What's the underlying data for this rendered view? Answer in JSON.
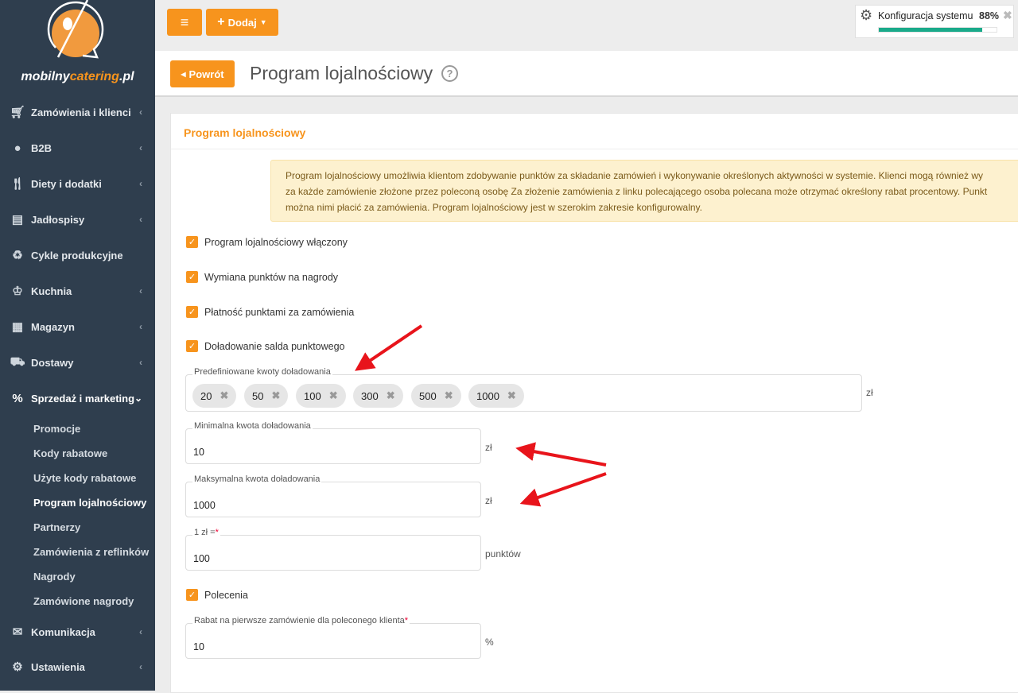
{
  "brand": {
    "name_part1": "mobilny",
    "name_part2": "catering",
    "name_part3": ".pl"
  },
  "sidebar": {
    "items": [
      {
        "label": "Zamówienia i klienci",
        "icon": "cart-icon"
      },
      {
        "label": "B2B",
        "icon": "user-icon"
      },
      {
        "label": "Diety i dodatki",
        "icon": "cutlery-icon"
      },
      {
        "label": "Jadłospisy",
        "icon": "list-icon"
      },
      {
        "label": "Cykle produkcyjne",
        "icon": "recycle-icon"
      },
      {
        "label": "Kuchnia",
        "icon": "chef-hat-icon"
      },
      {
        "label": "Magazyn",
        "icon": "boxes-icon"
      },
      {
        "label": "Dostawy",
        "icon": "truck-icon"
      },
      {
        "label": "Sprzedaż i marketing",
        "icon": "percent-icon"
      }
    ],
    "subitems": [
      "Promocje",
      "Kody rabatowe",
      "Użyte kody rabatowe",
      "Program lojalnościowy",
      "Partnerzy",
      "Zamówienia z reflinków",
      "Nagrody",
      "Zamówione nagrody"
    ],
    "bottom": [
      {
        "label": "Komunikacja",
        "icon": "envelope-icon"
      },
      {
        "label": "Ustawienia",
        "icon": "gear-icon"
      }
    ]
  },
  "topbar": {
    "menu_icon": "≡",
    "add_label": "Dodaj"
  },
  "config": {
    "label": "Konfiguracja systemu",
    "percent_text": "88%",
    "progress": 0.88,
    "color": "#1aaa8a"
  },
  "header": {
    "back_label": "Powrót",
    "title": "Program lojalnościowy"
  },
  "card": {
    "title": "Program lojalnościowy",
    "info_lines": [
      "Program lojalnościowy umożliwia klientom zdobywanie punktów za składanie zamówień i wykonywanie określonych aktywności w systemie. Klienci mogą również wy",
      "za każde zamówienie złożone przez poleconą osobę Za złożenie zamówienia z linku polecającego osoba polecana może otrzymać określony rabat procentowy. Punkt",
      "można nimi płacić za zamówienia. Program lojalnościowy jest w szerokim zakresie konfigurowalny."
    ],
    "checkboxes": [
      "Program lojalnościowy włączony",
      "Wymiana punktów na nagrody",
      "Płatność punktami za zamówienia",
      "Doładowanie salda punktowego"
    ],
    "predefined": {
      "label": "Predefiniowane kwoty doładowania",
      "values": [
        "20",
        "50",
        "100",
        "300",
        "500",
        "1000"
      ],
      "unit": "zł"
    },
    "min": {
      "label": "Minimalna kwota doładowania",
      "value": "10",
      "unit": "zł"
    },
    "max": {
      "label": "Maksymalna kwota doładowania",
      "value": "1000",
      "unit": "zł"
    },
    "rate": {
      "label": "1 zł =",
      "required": "*",
      "value": "100",
      "unit": "punktów"
    },
    "referrals": "Polecenia",
    "discount": {
      "label": "Rabat na pierwsze zamówienie dla poleconego klienta",
      "required": "*",
      "value": "10",
      "unit": "%"
    }
  },
  "accent": "#f7941d"
}
